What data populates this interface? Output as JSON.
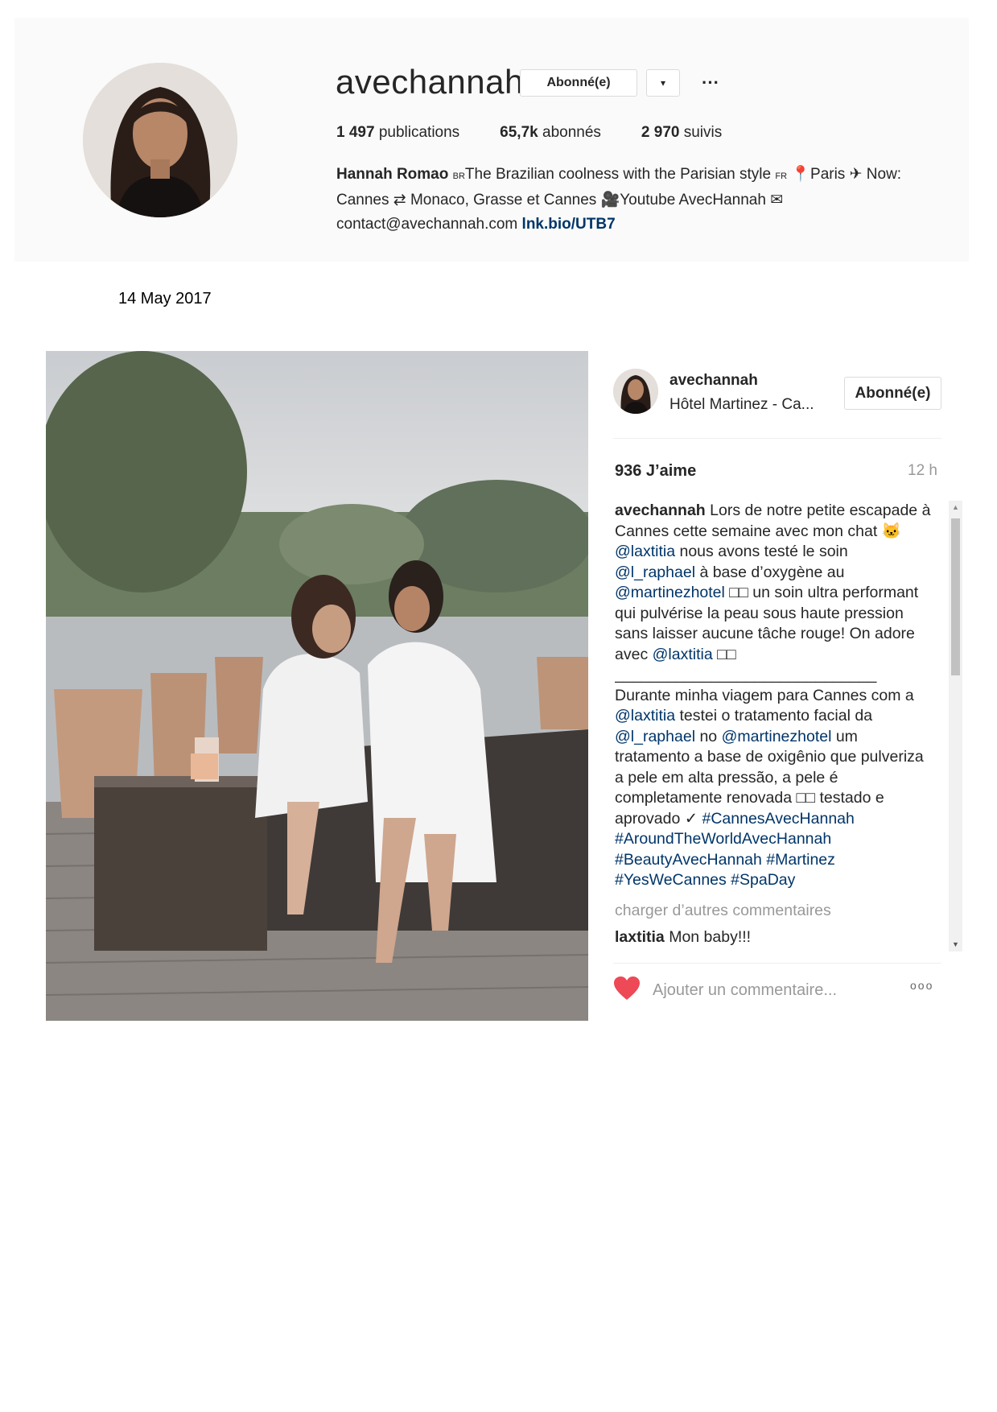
{
  "profile": {
    "username": "avechannah",
    "follow_label": "Abonné(e)",
    "caret": "▾",
    "more": "···",
    "stats": {
      "posts_num": "1 497",
      "posts_label": "publications",
      "followers_num": "65,7k",
      "followers_label": "abonnés",
      "following_num": "2 970",
      "following_label": "suivis"
    },
    "bio": {
      "name": "Hannah Romao",
      "br": "BR",
      "text1": "The Brazilian coolness with the Parisian style",
      "fr": "FR",
      "pin": "📍",
      "city": "Paris",
      "plane": "✈",
      "now": " Now:",
      "line2a": "Cannes",
      "soon_icon": "⇄",
      "line2b": " Monaco, Grasse et Cannes ",
      "camera": "🎥",
      "line2c": "Youtube AvecHannah ",
      "mail": "✉",
      "email": "contact@avechannah.com",
      "link": "lnk.bio/UTB7"
    }
  },
  "date": "14 May 2017",
  "post": {
    "username": "avechannah",
    "location": "Hôtel Martinez - Ca...",
    "follow_label": "Abonné(e)",
    "likes": "936 J’aime",
    "time": "12 h",
    "caption_user": "avechannah",
    "caption_fr_1": " Lors de notre petite escapade à Cannes cette semaine avec mon chat 🐱 ",
    "mention_laxtitia": "@laxtitia",
    "caption_fr_2": " nous avons testé le soin ",
    "mention_raphael": "@l_raphael",
    "caption_fr_3": " à base d’oxygène au ",
    "mention_martinez": "@martinezhotel",
    "caption_fr_4": " □□ un soin ultra performant qui pulvérise la peau sous haute pression sans laisser aucune tâche rouge! On adore avec ",
    "caption_fr_5": " □□",
    "separator": "______________________________",
    "caption_pt_1": "Durante minha viagem para Cannes com a ",
    "caption_pt_2": " testei o tratamento facial da ",
    "caption_pt_3": " no ",
    "caption_pt_4": " um tratamento a base de oxigênio que pulveriza a pele em alta pressão, a pele é completamente renovada □□ testado e aprovado ✓ ",
    "hashtags": "#CannesAvecHannah #AroundTheWorldAvecHannah #BeautyAvecHannah #Martinez #YesWeCannes #SpaDay",
    "load_more": "charger d’autres commentaires",
    "reply_user": "laxtitia",
    "reply_text": " Mon baby!!!",
    "comment_placeholder": "Ajouter un commentaire...",
    "options": "ooo"
  },
  "colors": {
    "heart": "#ed4956",
    "link": "#003569",
    "muted": "#999999"
  }
}
